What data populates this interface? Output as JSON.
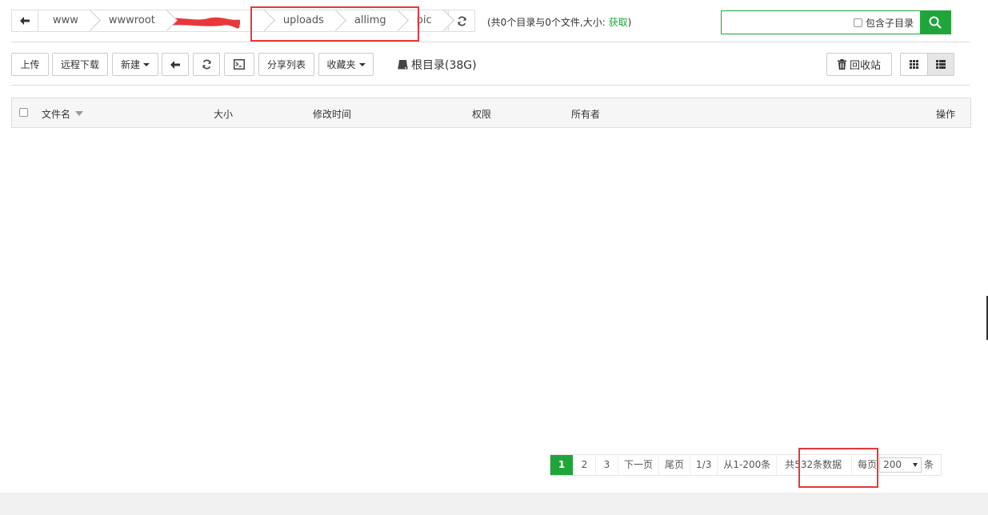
{
  "breadcrumb": {
    "items": [
      "www",
      "wwwroot",
      "",
      "uploads",
      "allimg",
      "pic"
    ],
    "dir_info_text": "(共0个目录与0个文件,大小:",
    "dir_info_fetch": "获取",
    "dir_info_close": ")"
  },
  "search": {
    "placeholder": "",
    "include_subdirs_label": "包含子目录"
  },
  "toolbar": {
    "upload": "上传",
    "remote_download": "远程下载",
    "new": "新建",
    "share_list": "分享列表",
    "favorites": "收藏夹",
    "root_dir": "根目录(38G)",
    "recycle_bin": "回收站"
  },
  "table": {
    "columns": {
      "name": "文件名",
      "size": "大小",
      "modified": "修改时间",
      "perms": "权限",
      "owner": "所有者",
      "actions": "操作"
    },
    "rows": []
  },
  "pagination": {
    "current": "1",
    "pages": [
      "2",
      "3"
    ],
    "next": "下一页",
    "last": "尾页",
    "page_of": "1/3",
    "range": "从1-200条",
    "total": "共532条数据",
    "per_page_prefix": "每页",
    "per_page_value": "200",
    "per_page_suffix": "条"
  },
  "colors": {
    "accent": "#20a53a",
    "highlight_box": "#e5383b"
  }
}
